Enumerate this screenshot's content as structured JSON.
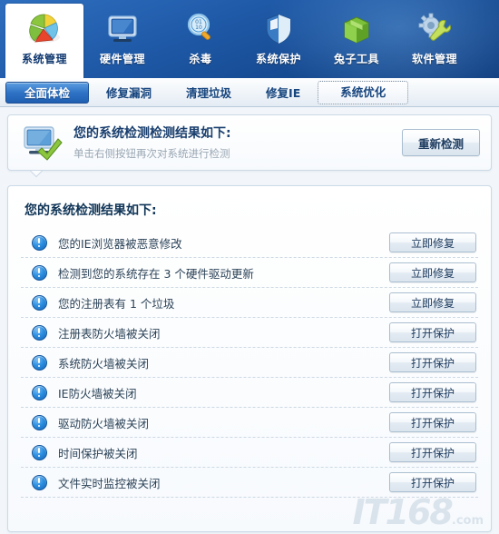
{
  "toolbar": {
    "items": [
      {
        "label": "系统管理",
        "icon": "pie-chart-icon",
        "active": true
      },
      {
        "label": "硬件管理",
        "icon": "monitor-icon",
        "active": false
      },
      {
        "label": "杀毒",
        "icon": "magnifier-icon",
        "active": false
      },
      {
        "label": "系统保护",
        "icon": "shield-icon",
        "active": false
      },
      {
        "label": "兔子工具",
        "icon": "green-box-icon",
        "active": false
      },
      {
        "label": "软件管理",
        "icon": "gear-wrench-icon",
        "active": false
      }
    ]
  },
  "subtabs": {
    "items": [
      {
        "label": "全面体检",
        "state": "active"
      },
      {
        "label": "修复漏洞",
        "state": "normal"
      },
      {
        "label": "清理垃圾",
        "state": "normal"
      },
      {
        "label": "修复IE",
        "state": "normal"
      },
      {
        "label": "系统优化",
        "state": "focused"
      }
    ]
  },
  "banner": {
    "icon": "monitor-check-icon",
    "title": "您的系统检测检测结果如下:",
    "subtitle": "单击右侧按钮再次对系统进行检测",
    "button_label": "重新检测"
  },
  "results": {
    "title": "您的系统检测结果如下:",
    "rows": [
      {
        "icon": "info-alert-icon",
        "label": "您的IE浏览器被恶意修改",
        "action": "立即修复"
      },
      {
        "icon": "info-alert-icon",
        "label": "检测到您的系统存在 3 个硬件驱动更新",
        "action": "立即修复"
      },
      {
        "icon": "info-alert-icon",
        "label": "您的注册表有 1 个垃圾",
        "action": "立即修复"
      },
      {
        "icon": "info-alert-icon",
        "label": "注册表防火墙被关闭",
        "action": "打开保护"
      },
      {
        "icon": "info-alert-icon",
        "label": "系统防火墙被关闭",
        "action": "打开保护"
      },
      {
        "icon": "info-alert-icon",
        "label": "IE防火墙被关闭",
        "action": "打开保护"
      },
      {
        "icon": "info-alert-icon",
        "label": "驱动防火墙被关闭",
        "action": "打开保护"
      },
      {
        "icon": "info-alert-icon",
        "label": "时间保护被关闭",
        "action": "打开保护"
      },
      {
        "icon": "info-alert-icon",
        "label": "文件实时监控被关闭",
        "action": "打开保护"
      }
    ]
  },
  "watermark": {
    "text": "IT168",
    "suffix": ".com"
  },
  "colors": {
    "header_blue": "#1b549f",
    "accent_blue": "#2f73c6",
    "alert_icon": "#1666b8",
    "title_text": "#103557",
    "panel_border": "#cbd9e6"
  }
}
